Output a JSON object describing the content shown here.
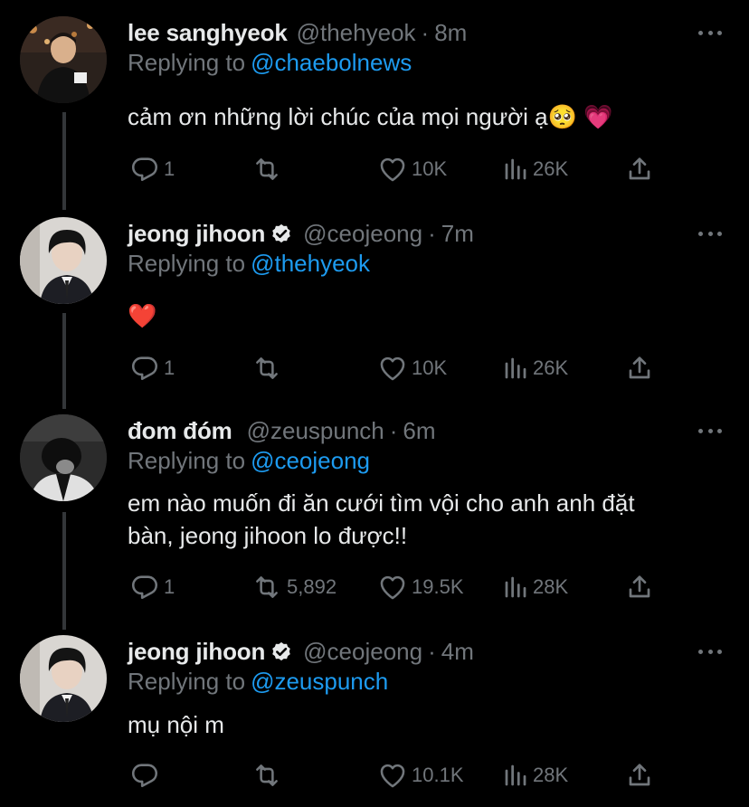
{
  "tweets": [
    {
      "name": "lee sanghyeok",
      "verified": false,
      "handle": "@thehyeok",
      "time": "8m",
      "replying_label": "Replying to",
      "replying_to": "@chaebolnews",
      "text_lines": [
        "cảm ơn những lời chúc của mọi người ạ🥺 💗"
      ],
      "replies": "1",
      "retweets": "",
      "likes": "10K",
      "views": "26K"
    },
    {
      "name": "jeong jihoon",
      "verified": true,
      "handle": "@ceojeong",
      "time": "7m",
      "replying_label": "Replying to",
      "replying_to": "@thehyeok",
      "text_lines": [
        "❤️"
      ],
      "replies": "1",
      "retweets": "",
      "likes": "10K",
      "views": "26K"
    },
    {
      "name": "đom đóm",
      "verified": false,
      "handle": "@zeuspunch",
      "time": "6m",
      "replying_label": "Replying to",
      "replying_to": "@ceojeong",
      "text_lines": [
        "em nào muốn đi ăn cưới tìm vội cho anh anh đặt",
        "bàn, jeong jihoon lo được!!"
      ],
      "replies": "1",
      "retweets": "5,892",
      "likes": "19.5K",
      "views": "28K"
    },
    {
      "name": "jeong jihoon",
      "verified": true,
      "handle": "@ceojeong",
      "time": "4m",
      "replying_label": "Replying to",
      "replying_to": "@zeuspunch",
      "text_lines": [
        "mụ nội m"
      ],
      "replies": "",
      "retweets": "",
      "likes": "10.1K",
      "views": "28K"
    }
  ],
  "icons": {
    "reply": "reply-icon",
    "retweet": "retweet-icon",
    "like": "heart-icon",
    "views": "views-icon",
    "share": "share-icon",
    "more": "more-icon",
    "verified": "verified-badge-icon"
  },
  "colors": {
    "background": "#000000",
    "text": "#e7e9ea",
    "secondary": "#71767b",
    "link": "#1d9bf0",
    "thread_line": "#333639"
  }
}
